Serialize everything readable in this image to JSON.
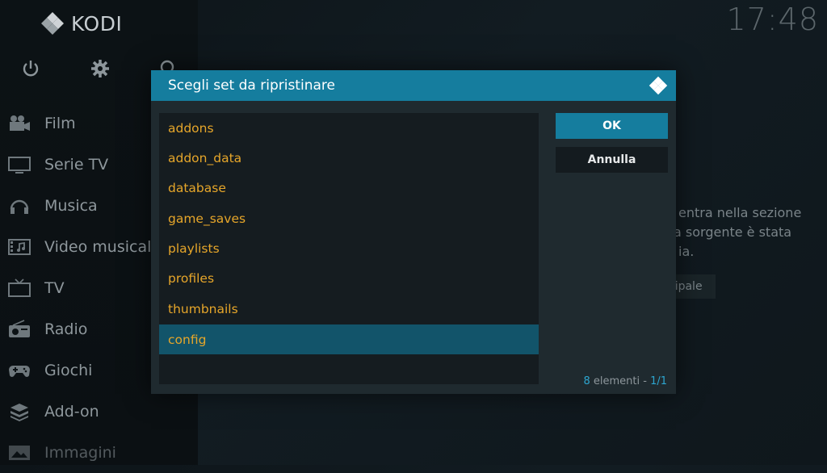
{
  "app": {
    "name": "KODI"
  },
  "clock": {
    "time": "17:48"
  },
  "top_icons": [
    "power-icon",
    "gear-icon",
    "search-icon"
  ],
  "sidebar": {
    "items": [
      {
        "label": "Film",
        "icon": "film-camera-icon"
      },
      {
        "label": "Serie TV",
        "icon": "tv-monitor-icon"
      },
      {
        "label": "Musica",
        "icon": "headphones-icon"
      },
      {
        "label": "Video musicali",
        "icon": "music-video-icon"
      },
      {
        "label": "TV",
        "icon": "television-icon"
      },
      {
        "label": "Radio",
        "icon": "radio-icon"
      },
      {
        "label": "Giochi",
        "icon": "gamepad-icon"
      },
      {
        "label": "Add-on",
        "icon": "addon-box-icon"
      },
      {
        "label": "Immagini",
        "icon": "pictures-icon"
      }
    ]
  },
  "background_info": {
    "line1": "entra nella sezione",
    "line2": "a sorgente è stata",
    "line3": "ia.",
    "button": "cipale"
  },
  "dialog": {
    "title": "Scegli set da ripristinare",
    "items": [
      "addons",
      "addon_data",
      "database",
      "game_saves",
      "playlists",
      "profiles",
      "thumbnails",
      "config"
    ],
    "selected_index": 7,
    "ok_label": "OK",
    "cancel_label": "Annulla",
    "count_number": "8",
    "count_text": " elementi - ",
    "page": "1/1"
  },
  "colors": {
    "accent": "#157d9e",
    "item_text": "#e6a62a",
    "selected_bg": "#12546a"
  }
}
